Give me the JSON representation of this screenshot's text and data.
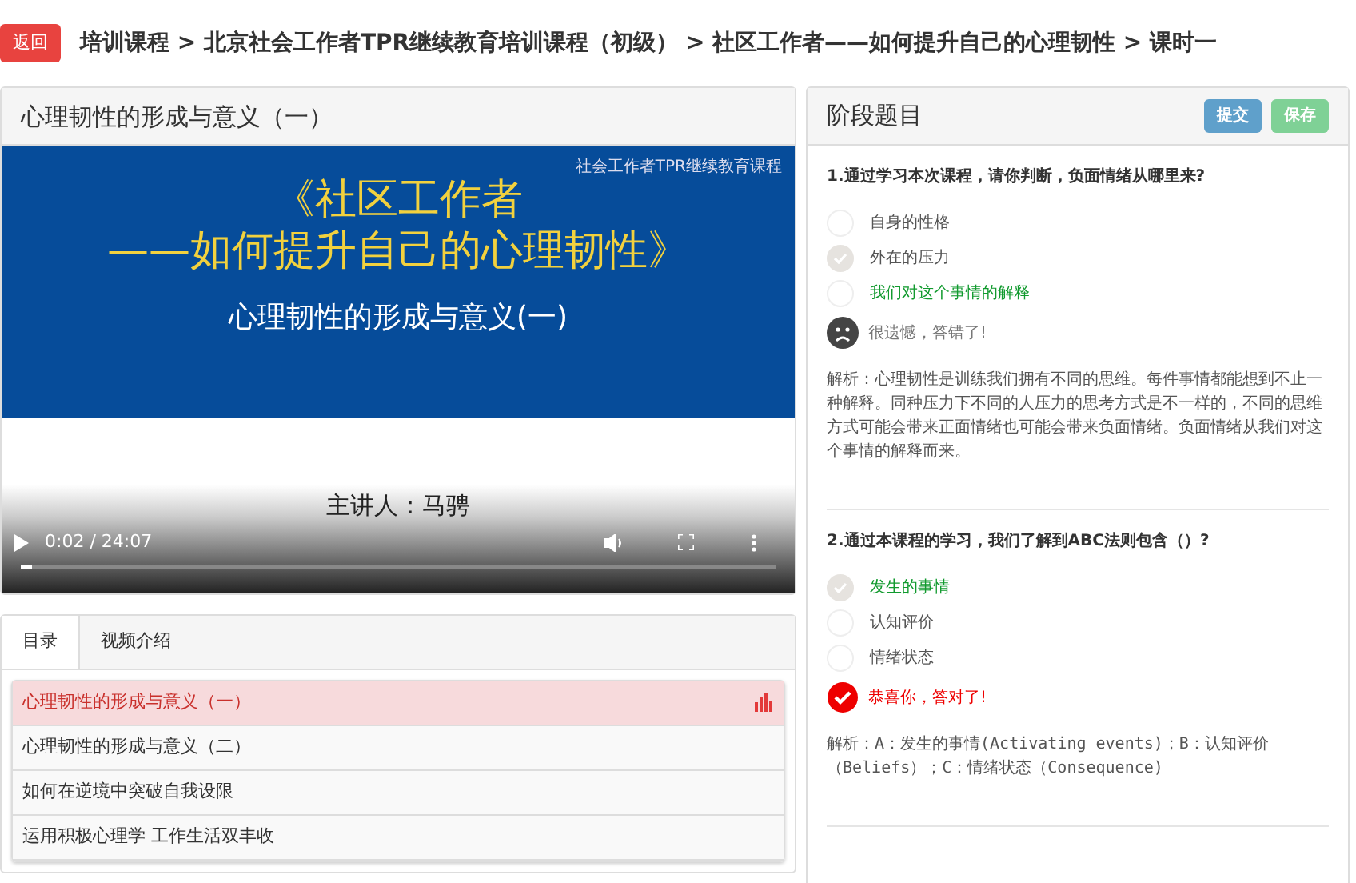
{
  "back_button": "返回",
  "breadcrumb": "培训课程 > 北京社会工作者TPR继续教育培训课程（初级） > 社区工作者——如何提升自己的心理韧性 > 课时一",
  "video_panel": {
    "title": "心理韧性的形成与意义（一）",
    "slide": {
      "corner_text": "社会工作者TPR继续教育课程",
      "title_lines": [
        "《社区工作者",
        "——如何提升自己的心理韧性》"
      ],
      "subtitle": "心理韧性的形成与意义(一)"
    },
    "speaker": "主讲人：马骋",
    "time": "0:02 / 24:07",
    "progress": {
      "level": 0.015
    }
  },
  "tabs": [
    {
      "label": "目录",
      "selected": true
    },
    {
      "label": "视频介绍",
      "selected": false
    }
  ],
  "lessons": [
    {
      "title": "心理韧性的形成与意义（一）",
      "selected": true
    },
    {
      "title": "心理韧性的形成与意义（二）",
      "selected": false
    },
    {
      "title": "如何在逆境中突破自我设限",
      "selected": false
    },
    {
      "title": "运用积极心理学 工作生活双丰收",
      "selected": false
    }
  ],
  "quiz": {
    "title": "阶段题目",
    "buttons": [
      {
        "label": "提交",
        "kind": "submit"
      },
      {
        "label": "保存",
        "kind": "save"
      }
    ],
    "questions": [
      {
        "text": "1.通过学习本次课程，请你判断，负面情绪从哪里来?",
        "options": [
          {
            "text": "自身的性格",
            "selected": false,
            "correct": false
          },
          {
            "text": "外在的压力",
            "selected": true,
            "correct": false
          },
          {
            "text": "我们对这个事情的解释",
            "selected": false,
            "correct": true
          }
        ],
        "result": {
          "kind": "wrong",
          "text": "很遗憾，答错了!"
        },
        "explanation": "解析：心理韧性是训练我们拥有不同的思维。每件事情都能想到不止一种解释。同种压力下不同的人压力的思考方式是不一样的，不同的思维方式可能会带来正面情绪也可能会带来负面情绪。负面情绪从我们对这个事情的解释而来。",
        "mono": false
      },
      {
        "text": "2.通过本课程的学习，我们了解到ABC法则包含（）?",
        "options": [
          {
            "text": "发生的事情",
            "selected": true,
            "correct": true
          },
          {
            "text": "认知评价",
            "selected": false,
            "correct": false
          },
          {
            "text": "情绪状态",
            "selected": false,
            "correct": false
          }
        ],
        "result": {
          "kind": "right",
          "text": "恭喜你，答对了!"
        },
        "explanation": "解析：A：发生的事情(Activating events)；B：认知评价（Beliefs）；C：情绪状态（Consequence)",
        "mono": true
      }
    ]
  }
}
